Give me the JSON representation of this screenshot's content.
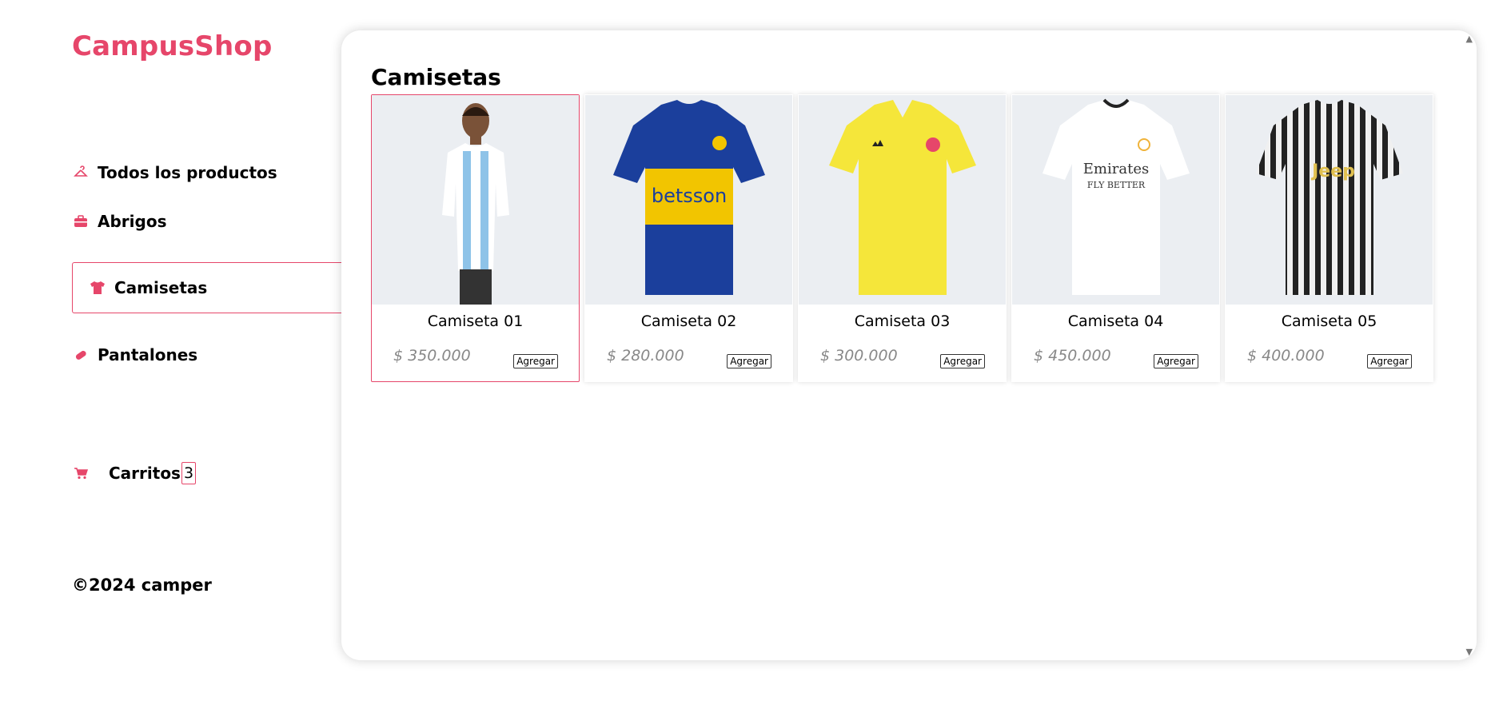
{
  "brand": "CampusShop",
  "nav": {
    "items": [
      {
        "label": "Todos los productos",
        "icon": "hanger-icon"
      },
      {
        "label": "Abrigos",
        "icon": "briefcase-icon"
      },
      {
        "label": "Camisetas",
        "icon": "shirt-icon",
        "active": true
      },
      {
        "label": "Pantalones",
        "icon": "bandage-icon"
      }
    ],
    "cart_label": "Carritos",
    "cart_count": "3"
  },
  "footer": "©2024 camper",
  "main": {
    "title": "Camisetas",
    "products": [
      {
        "name": "Camiseta 01",
        "price": "$ 350.000",
        "button": "Agregar",
        "colors": [
          "#ffffff",
          "#8ec3e8"
        ]
      },
      {
        "name": "Camiseta 02",
        "price": "$ 280.000",
        "button": "Agregar",
        "colors": [
          "#1b3f9c",
          "#f2c500"
        ]
      },
      {
        "name": "Camiseta 03",
        "price": "$ 300.000",
        "button": "Agregar",
        "colors": [
          "#f5e63a",
          "#f5e63a"
        ]
      },
      {
        "name": "Camiseta 04",
        "price": "$ 450.000",
        "button": "Agregar",
        "colors": [
          "#ffffff",
          "#f0b33a"
        ]
      },
      {
        "name": "Camiseta 05",
        "price": "$ 400.000",
        "button": "Agregar",
        "colors": [
          "#222222",
          "#f0f0f0"
        ]
      }
    ],
    "jersey_texts": [
      "betsson",
      "Emirates",
      "FLY BETTER",
      "Jeep"
    ]
  },
  "accent_color": "#e6466a"
}
